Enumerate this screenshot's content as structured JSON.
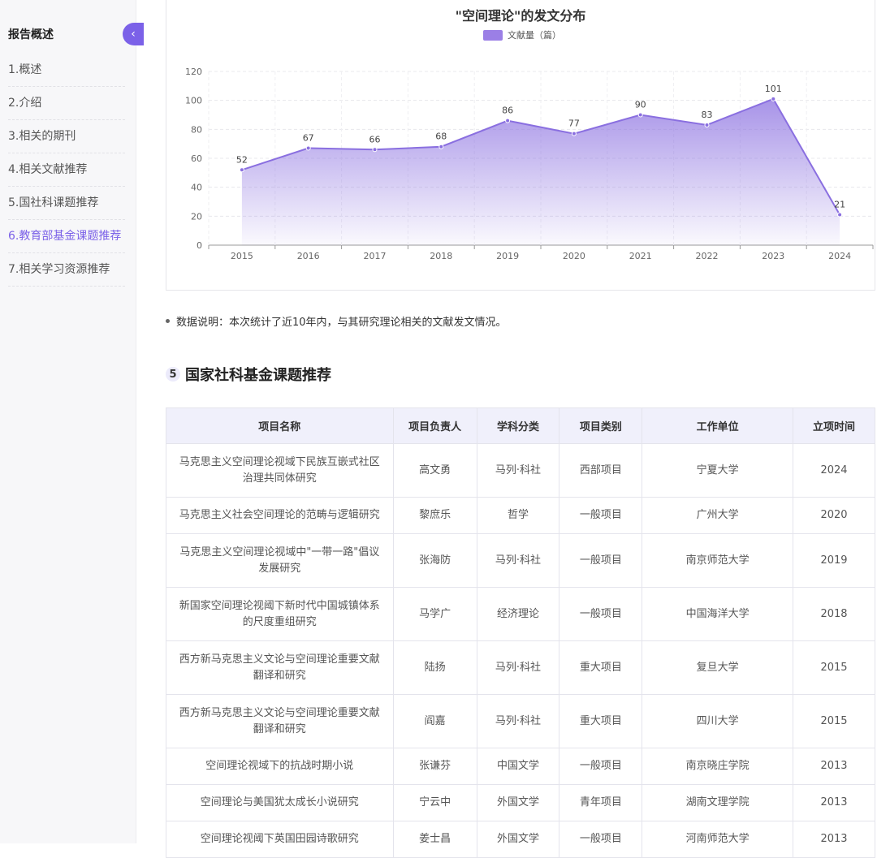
{
  "sidebar": {
    "title": "报告概述",
    "collapse_icon": "‹",
    "items": [
      {
        "label": "1.概述",
        "active": false
      },
      {
        "label": "2.介绍",
        "active": false
      },
      {
        "label": "3.相关的期刊",
        "active": false
      },
      {
        "label": "4.相关文献推荐",
        "active": false
      },
      {
        "label": "5.国社科课题推荐",
        "active": false
      },
      {
        "label": "6.教育部基金课题推荐",
        "active": true
      },
      {
        "label": "7.相关学习资源推荐",
        "active": false
      }
    ]
  },
  "chart": {
    "legend_label": "文献量（篇）",
    "accent_color": "#8a6fe0"
  },
  "chart_data": {
    "type": "area",
    "title": "\"空间理论\"的发文分布",
    "categories": [
      "2015",
      "2016",
      "2017",
      "2018",
      "2019",
      "2020",
      "2021",
      "2022",
      "2023",
      "2024"
    ],
    "series": [
      {
        "name": "文献量（篇）",
        "values": [
          52,
          67,
          66,
          68,
          86,
          77,
          90,
          83,
          101,
          21
        ]
      }
    ],
    "y_ticks": [
      0,
      20,
      40,
      60,
      80,
      100,
      120
    ],
    "ylim": [
      0,
      120
    ],
    "grid": true,
    "legend_position": "top-center"
  },
  "note": "数据说明：本次统计了近10年内，与其研究理论相关的文献发文情况。",
  "section": {
    "number": "5",
    "title": "国家社科基金课题推荐"
  },
  "table": {
    "headers": [
      "项目名称",
      "项目负责人",
      "学科分类",
      "项目类别",
      "工作单位",
      "立项时间"
    ],
    "rows": [
      {
        "name": "马克思主义空间理论视域下民族互嵌式社区治理共同体研究",
        "leader": "高文勇",
        "discipline": "马列·科社",
        "category": "西部项目",
        "unit": "宁夏大学",
        "year": "2024"
      },
      {
        "name": "马克思主义社会空间理论的范畴与逻辑研究",
        "leader": "黎庶乐",
        "discipline": "哲学",
        "category": "一般项目",
        "unit": "广州大学",
        "year": "2020"
      },
      {
        "name": "马克思主义空间理论视域中\"一带一路\"倡议发展研究",
        "leader": "张海防",
        "discipline": "马列·科社",
        "category": "一般项目",
        "unit": "南京师范大学",
        "year": "2019"
      },
      {
        "name": "新国家空间理论视阈下新时代中国城镇体系的尺度重组研究",
        "leader": "马学广",
        "discipline": "经济理论",
        "category": "一般项目",
        "unit": "中国海洋大学",
        "year": "2018"
      },
      {
        "name": "西方新马克思主义文论与空间理论重要文献翻译和研究",
        "leader": "陆扬",
        "discipline": "马列·科社",
        "category": "重大项目",
        "unit": "复旦大学",
        "year": "2015"
      },
      {
        "name": "西方新马克思主义文论与空间理论重要文献翻译和研究",
        "leader": "阎嘉",
        "discipline": "马列·科社",
        "category": "重大项目",
        "unit": "四川大学",
        "year": "2015"
      },
      {
        "name": "空间理论视域下的抗战时期小说",
        "leader": "张谦芬",
        "discipline": "中国文学",
        "category": "一般项目",
        "unit": "南京晓庄学院",
        "year": "2013"
      },
      {
        "name": "空间理论与美国犹太成长小说研究",
        "leader": "宁云中",
        "discipline": "外国文学",
        "category": "青年项目",
        "unit": "湖南文理学院",
        "year": "2013"
      },
      {
        "name": "空间理论视阈下英国田园诗歌研究",
        "leader": "姜士昌",
        "discipline": "外国文学",
        "category": "一般项目",
        "unit": "河南师范大学",
        "year": "2013"
      }
    ]
  }
}
